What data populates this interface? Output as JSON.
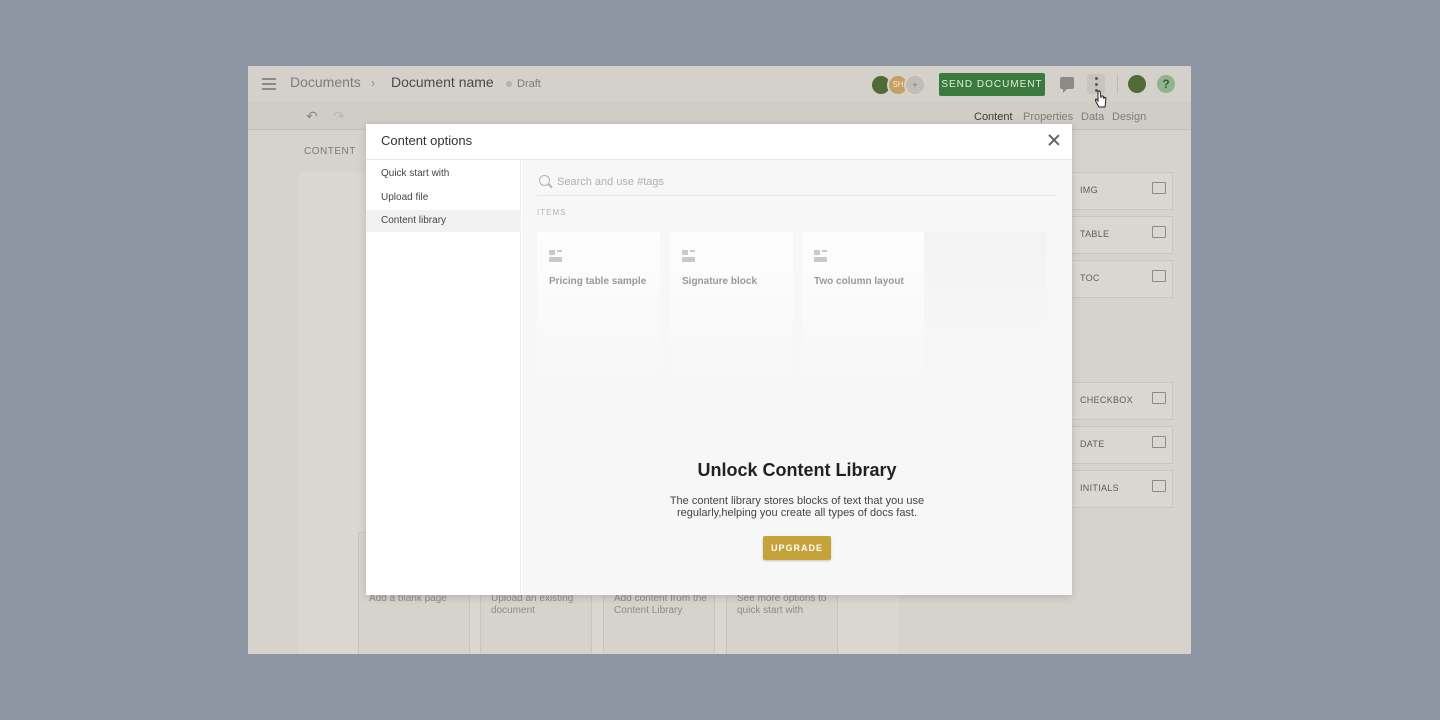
{
  "header": {
    "breadcrumb_root": "Documents",
    "breadcrumb_sep": "›",
    "document_name": "Document name",
    "status": "Draft",
    "collaborator_initials": "SH",
    "send_label": "SEND DOCUMENT",
    "help_label": "?"
  },
  "toolbar": {
    "undo": "↶",
    "redo": "↷",
    "tabs": [
      "Content",
      "Properties",
      "Data",
      "Design"
    ]
  },
  "canvas": {
    "section_label": "CONTENT",
    "cards": [
      "Add a blank page",
      "Upload an existing document",
      "Add content from the Content Library",
      "See more options to quick start with"
    ]
  },
  "panel": {
    "items": [
      {
        "label": "IMG",
        "icon": "image-icon"
      },
      {
        "label": "TABLE",
        "icon": "table-icon"
      },
      {
        "label": "TOC",
        "icon": "toc-icon"
      },
      {
        "label": "CHECKBOX",
        "icon": "checkbox-icon"
      },
      {
        "label": "DATE",
        "icon": "calendar-icon"
      },
      {
        "label": "INITIALS",
        "icon": "initials-icon"
      }
    ]
  },
  "modal": {
    "title": "Content options",
    "nav": [
      "Quick start with",
      "Upload file",
      "Content library"
    ],
    "selected_nav": "Content library",
    "search_placeholder": "Search and use #tags",
    "items_label": "ITEMS",
    "items": [
      "Pricing table sample",
      "Signature block",
      "Two column layout"
    ],
    "unlock_title": "Unlock Content Library",
    "unlock_desc": "The content library stores blocks of text that you use regularly,helping you create all types of docs fast.",
    "upgrade_label": "UPGRADE"
  },
  "colors": {
    "accent_green": "#3a7a3c",
    "upgrade_gold": "#c6a23a",
    "backdrop": "#8e95a3"
  }
}
